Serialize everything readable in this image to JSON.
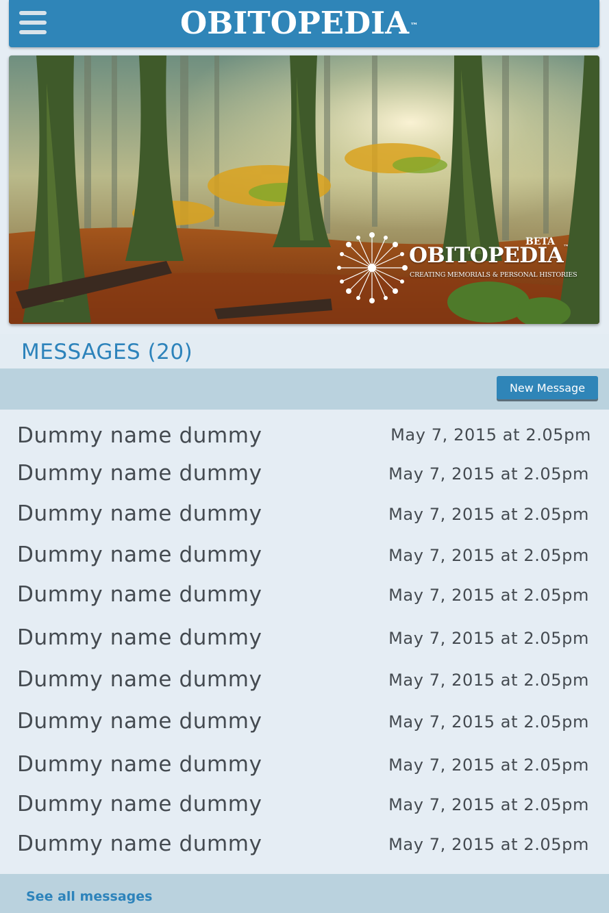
{
  "header": {
    "menu_icon": "hamburger-menu-icon",
    "logo": "OBITOPEDIA",
    "logo_tm": "™"
  },
  "hero": {
    "image": "autumn forest",
    "beta": "BETA",
    "logo": "OBITOPEDIA",
    "logo_tm": "™",
    "tagline": "CREATING MEMORIALS & PERSONAL HISTORIES"
  },
  "messages": {
    "title": "MESSAGES (20)",
    "new_message_label": "New Message",
    "items": [
      {
        "name": "Dummy name dummy",
        "date": "May 7, 2015 at 2.05pm"
      },
      {
        "name": "Dummy name dummy",
        "date": "May 7, 2015 at 2.05pm"
      },
      {
        "name": "Dummy name dummy",
        "date": "May 7, 2015 at 2.05pm"
      },
      {
        "name": "Dummy name dummy",
        "date": "May 7, 2015 at 2.05pm"
      },
      {
        "name": "Dummy name dummy",
        "date": "May 7, 2015 at 2.05pm"
      },
      {
        "name": "Dummy name dummy",
        "date": "May 7, 2015 at 2.05pm"
      },
      {
        "name": "Dummy name dummy",
        "date": "May 7, 2015 at 2.05pm"
      },
      {
        "name": "Dummy name dummy",
        "date": "May 7, 2015 at 2.05pm"
      },
      {
        "name": "Dummy name dummy",
        "date": "May 7, 2015 at 2.05pm"
      },
      {
        "name": "Dummy name dummy",
        "date": "May 7, 2015 at 2.05pm"
      },
      {
        "name": "Dummy name dummy",
        "date": "May 7, 2015 at 2.05pm"
      }
    ],
    "see_all_label": "See all messages"
  },
  "colors": {
    "brand_blue": "#2f85b8",
    "title_blue": "#2d83bb",
    "page_bg": "#e5edf4",
    "band_bg": "#bad2de",
    "text": "#444a50"
  }
}
